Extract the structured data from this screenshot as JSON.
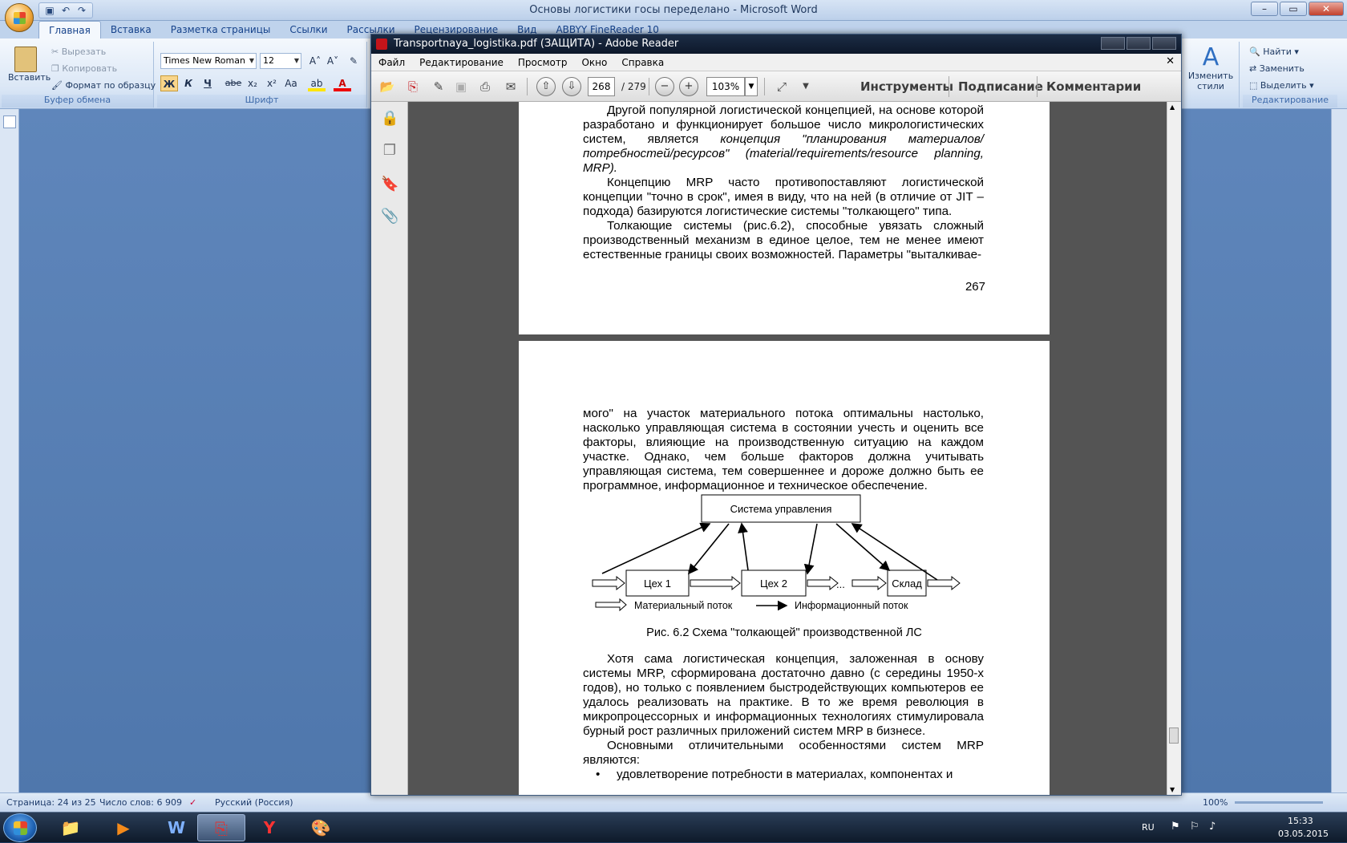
{
  "word": {
    "title": "Основы логистики госы переделано - Microsoft Word",
    "tabs": [
      "Главная",
      "Вставка",
      "Разметка страницы",
      "Ссылки",
      "Рассылки",
      "Рецензирование",
      "Вид",
      "ABBYY FineReader 10"
    ],
    "clipboard": {
      "paste": "Вставить",
      "cut": "Вырезать",
      "copy": "Копировать",
      "format_painter": "Формат по образцу",
      "group": "Буфер обмена"
    },
    "font": {
      "family": "Times New Roman",
      "size": "12",
      "group": "Шрифт",
      "bold": "Ж",
      "italic": "К",
      "underline": "Ч",
      "strike": "abe",
      "sub": "x₂",
      "sup": "x²",
      "case": "Aa"
    },
    "styles": {
      "change": "Изменить стили",
      "find": "Найти",
      "replace": "Заменить",
      "select": "Выделить",
      "group": "Редактирование"
    },
    "status": {
      "page": "Страница: 24 из 25",
      "words": "Число слов: 6 909",
      "lang": "Русский (Россия)",
      "zoom": "100%"
    }
  },
  "adobe": {
    "title": "Transportnaya_logistika.pdf (ЗАЩИТА) - Adobe Reader",
    "menu": [
      "Файл",
      "Редактирование",
      "Просмотр",
      "Окно",
      "Справка"
    ],
    "page_current": "268",
    "page_total": "/ 279",
    "zoom": "103%",
    "links": [
      "Инструменты",
      "Подписание",
      "Комментарии"
    ]
  },
  "page1": {
    "p1": "Другой популярной логистической концепцией, на основе которой разработано и функционирует большое число микрологистических систем, является ",
    "p1_italic": "концепция \"планирования материалов/потребностей/ресурсов\"",
    "p1_tail": " (material/requirements/resource planning, MRP).",
    "p2": "Концепцию MRP часто противопоставляют логистической концепции \"точно в срок\", имея в виду, что на ней (в отличие от JIT – подхода) базируются логистические системы \"толкающего\" типа.",
    "p3": "Толкающие системы (рис.6.2), способные увязать сложный производственный механизм в единое целое, тем не менее имеют естественные границы своих возможностей. Параметры \"выталкивае-",
    "page_number": "267"
  },
  "page2": {
    "p1": "мого\" на участок материального потока оптимальны настолько, насколько управляющая система в состоянии учесть и оценить все факторы, влияющие на производственную ситуацию на каждом участке. Однако, чем больше факторов должна учитывать управляющая система, тем совершеннее и дороже должно быть ее программное, информационное и техническое обеспечение.",
    "diagram": {
      "control": "Система управления",
      "shop1": "Цех 1",
      "shop2": "Цех 2",
      "dots": "...",
      "warehouse": "Склад",
      "legend_material": "Материальный поток",
      "legend_info": "Информационный поток",
      "caption": "Рис. 6.2 Схема \"толкающей\" производственной ЛС"
    },
    "p2": "Хотя сама логистическая концепция, заложенная в основу системы MRP, сформирована достаточно давно (с середины 1950-х годов), но только с появлением быстродействующих компьютеров ее удалось реализовать на практике. В то же время революция в микропроцессорных и информационных технологиях стимулировала бурный рост различных приложений систем MRP в бизнесе.",
    "p3": "Основными отличительными особенностями систем MRP являются:",
    "bullet": "удовлетворение потребности в материалах, компонентах и"
  },
  "taskbar": {
    "lang": "RU",
    "time": "15:33",
    "date": "03.05.2015"
  }
}
